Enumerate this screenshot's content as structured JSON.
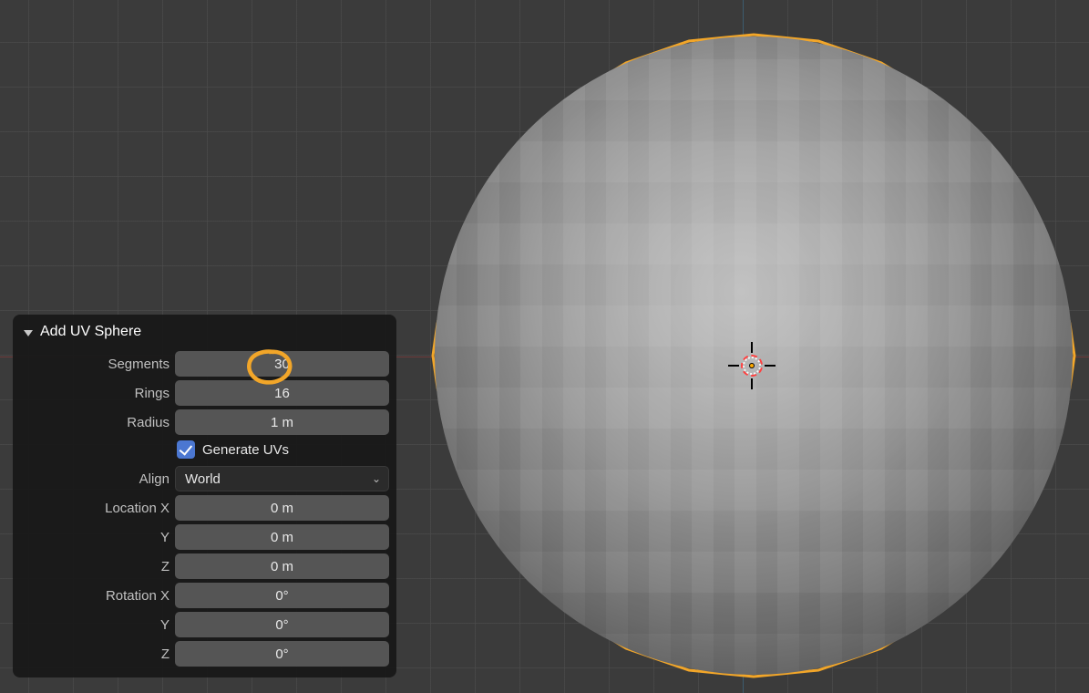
{
  "panel": {
    "title": "Add UV Sphere",
    "segments": {
      "label": "Segments",
      "value": "30"
    },
    "rings": {
      "label": "Rings",
      "value": "16"
    },
    "radius": {
      "label": "Radius",
      "value": "1 m"
    },
    "generate_uvs": {
      "label": "Generate UVs",
      "checked": true
    },
    "align": {
      "label": "Align",
      "value": "World"
    },
    "location": {
      "x": {
        "label": "Location X",
        "value": "0 m"
      },
      "y": {
        "label": "Y",
        "value": "0 m"
      },
      "z": {
        "label": "Z",
        "value": "0 m"
      }
    },
    "rotation": {
      "x": {
        "label": "Rotation X",
        "value": "0°"
      },
      "y": {
        "label": "Y",
        "value": "0°"
      },
      "z": {
        "label": "Z",
        "value": "0°"
      }
    }
  },
  "highlight": {
    "color": "#f2a629"
  },
  "geometry": {
    "type": "uv_sphere",
    "segments": 30,
    "rings": 16,
    "radius_m": 1
  }
}
